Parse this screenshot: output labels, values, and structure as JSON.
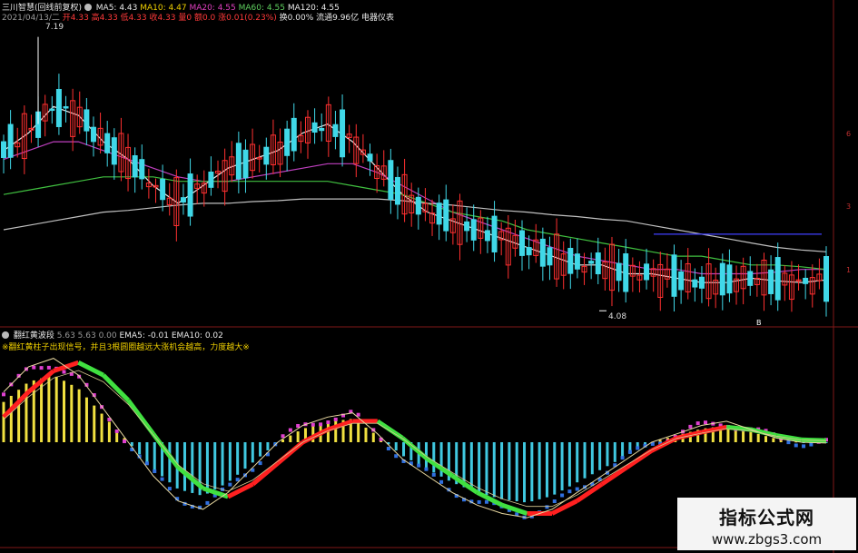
{
  "header": {
    "stock_name": "三川智慧(回线前复权)",
    "ma5": "MA5: 4.43",
    "ma10": "MA10: 4.47",
    "ma20": "MA20: 4.55",
    "ma60": "MA60: 4.55",
    "ma120": "MA120: 4.55",
    "date_line": "2021/04/13/二",
    "quote_line": "开4.33 高4.33 低4.33 收4.33 量0 额0.0 涨0.01(0.23%)",
    "extra_line": "换0.00% 流通9.96亿 电器仪表"
  },
  "indicator": {
    "name": "翻红黄波段",
    "values": "5.63  5.63    0.00",
    "ema5": "EMA5: -0.01",
    "ema10": "EMA10: 0.02",
    "description": "※翻红黄柱子出现信号，并且3根圆圈越远大涨机会越高，力度越大※"
  },
  "annotations": {
    "high": "7.19",
    "low": "4.08",
    "marker": "B"
  },
  "watermark": {
    "title": "指标公式网",
    "url": "www.zbgs3.com"
  },
  "colors": {
    "up": "#ff3030",
    "down": "#40d8e8",
    "ma5": "#e8e8e8",
    "ma10": "#e8d070",
    "ma20": "#c040c0",
    "ma60": "#40c040",
    "ma120": "#c0c0c0",
    "ma_blue": "#4040ff",
    "bar_yellow": "#f0e040",
    "bar_cyan": "#40c8e0",
    "bar_blue": "#3070e0",
    "bar_pink": "#e040d0",
    "line_green": "#40e040",
    "line_red": "#ff2020"
  },
  "chart_data": [
    {
      "type": "candlestick",
      "title": "三川智慧(回线前复权)",
      "ylim": [
        4.0,
        7.3
      ],
      "series": [
        {
          "name": "MA5",
          "values": [
            5.9,
            6.1,
            6.4,
            6.3,
            6.0,
            5.8,
            5.5,
            5.3,
            5.5,
            5.7,
            5.8,
            5.9,
            6.1,
            6.2,
            6.0,
            5.7,
            5.4,
            5.2,
            5.1,
            5.0,
            4.9,
            4.8,
            4.7,
            4.6,
            4.6,
            4.5,
            4.5,
            4.45,
            4.4,
            4.4,
            4.45,
            4.42,
            4.4,
            4.43
          ]
        },
        {
          "name": "MA20",
          "values": [
            5.8,
            5.9,
            6.0,
            6.0,
            5.9,
            5.8,
            5.7,
            5.6,
            5.55,
            5.55,
            5.6,
            5.65,
            5.7,
            5.75,
            5.75,
            5.65,
            5.5,
            5.35,
            5.2,
            5.1,
            5.0,
            4.9,
            4.8,
            4.7,
            4.65,
            4.6,
            4.55,
            4.55,
            4.5,
            4.5,
            4.5,
            4.52,
            4.55,
            4.55
          ]
        },
        {
          "name": "MA60",
          "values": [
            5.4,
            5.45,
            5.5,
            5.55,
            5.6,
            5.6,
            5.6,
            5.55,
            5.55,
            5.55,
            5.55,
            5.55,
            5.55,
            5.55,
            5.5,
            5.45,
            5.4,
            5.3,
            5.2,
            5.15,
            5.1,
            5.0,
            4.95,
            4.9,
            4.85,
            4.8,
            4.75,
            4.7,
            4.7,
            4.65,
            4.6,
            4.6,
            4.58,
            4.55
          ]
        },
        {
          "name": "MA120",
          "values": [
            5.0,
            5.05,
            5.1,
            5.15,
            5.2,
            5.22,
            5.25,
            5.28,
            5.3,
            5.3,
            5.32,
            5.33,
            5.35,
            5.35,
            5.35,
            5.35,
            5.33,
            5.3,
            5.28,
            5.25,
            5.22,
            5.2,
            5.17,
            5.15,
            5.12,
            5.1,
            5.05,
            5.0,
            4.95,
            4.9,
            4.85,
            4.8,
            4.77,
            4.75
          ]
        }
      ],
      "high_label": 7.19,
      "low_label": 4.08
    },
    {
      "type": "bar",
      "title": "翻红黄波段",
      "series": [
        {
          "name": "EMA5",
          "values": [
            0.6,
            0.9,
            1.0,
            0.8,
            0.4,
            0.0,
            -0.4,
            -0.7,
            -0.8,
            -0.6,
            -0.3,
            0.0,
            0.2,
            0.3,
            0.35,
            0.1,
            -0.2,
            -0.4,
            -0.6,
            -0.75,
            -0.85,
            -0.9,
            -0.8,
            -0.6,
            -0.4,
            -0.2,
            0.0,
            0.1,
            0.2,
            0.25,
            0.15,
            0.05,
            0.0,
            -0.01
          ]
        },
        {
          "name": "EMA10",
          "values": [
            0.3,
            0.6,
            0.85,
            0.95,
            0.8,
            0.5,
            0.1,
            -0.3,
            -0.55,
            -0.65,
            -0.5,
            -0.25,
            0.0,
            0.15,
            0.25,
            0.25,
            0.05,
            -0.2,
            -0.4,
            -0.6,
            -0.75,
            -0.85,
            -0.85,
            -0.7,
            -0.5,
            -0.3,
            -0.1,
            0.05,
            0.12,
            0.18,
            0.15,
            0.08,
            0.03,
            0.02
          ]
        }
      ]
    }
  ]
}
